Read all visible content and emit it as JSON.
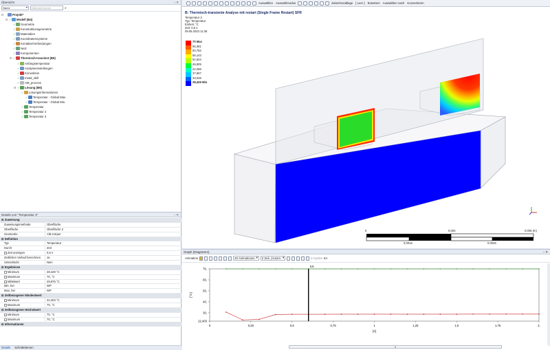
{
  "outline": {
    "title": "Übersicht",
    "filter_select": "Name",
    "filter_placeholder": "Übersicht durch",
    "tree": [
      {
        "label": "Projekt*",
        "bold": true,
        "indent": 0,
        "color": "#6b8fcf"
      },
      {
        "label": "Modell (B4)",
        "bold": true,
        "indent": 1,
        "color": "#5a9bd8"
      },
      {
        "label": "Geometrie",
        "bold": false,
        "indent": 2,
        "color": "#6ca86c"
      },
      {
        "label": "Konstruktionsgeometrie",
        "bold": false,
        "indent": 2,
        "color": "#c9a24a"
      },
      {
        "label": "Materialien",
        "bold": false,
        "indent": 2,
        "color": "#8aa6c9"
      },
      {
        "label": "Koordinatensysteme",
        "bold": false,
        "indent": 2,
        "color": "#7f9ab8"
      },
      {
        "label": "Kontakte/Verbindungen",
        "bold": false,
        "indent": 2,
        "color": "#c78a3a"
      },
      {
        "label": "Netz",
        "bold": false,
        "indent": 2,
        "color": "#66a37a"
      },
      {
        "label": "Komponenten",
        "bold": false,
        "indent": 2,
        "color": "#8c7fc0"
      },
      {
        "label": "Thermisch-transient (B5)",
        "bold": true,
        "indent": 2,
        "color": "#d04040"
      },
      {
        "label": "Anfangstemperatur",
        "bold": false,
        "indent": 3,
        "color": "#8fb35a"
      },
      {
        "label": "Analyseeinstellungen",
        "bold": false,
        "indent": 3,
        "color": "#6f95c7"
      },
      {
        "label": "Konvektion",
        "bold": false,
        "indent": 3,
        "color": "#d03c3c"
      },
      {
        "label": "metal_skill",
        "bold": false,
        "indent": 3,
        "color": "#7a9bc2"
      },
      {
        "label": "AM_process",
        "bold": false,
        "indent": 3,
        "color": "#b8b8b8"
      },
      {
        "label": "Lösung (B6)",
        "bold": true,
        "indent": 3,
        "color": "#5a9d5a"
      },
      {
        "label": "Lösungsinformationen",
        "bold": false,
        "indent": 4,
        "color": "#d0a040"
      },
      {
        "label": "Temperatur - Global Max.",
        "bold": false,
        "indent": 5,
        "color": "#4a7fc4"
      },
      {
        "label": "Temperatur - Global Min.",
        "bold": false,
        "indent": 5,
        "color": "#4a7fc4"
      },
      {
        "label": "Temperatur",
        "bold": false,
        "indent": 4,
        "color": "#5aa060"
      },
      {
        "label": "Temperatur 2",
        "bold": false,
        "indent": 4,
        "color": "#5aa060"
      },
      {
        "label": "Temperatur 3",
        "bold": false,
        "indent": 4,
        "color": "#5aa060"
      }
    ]
  },
  "details": {
    "title": "Details von \"Temperatur 3\"",
    "rows": [
      {
        "type": "sec",
        "k": "Zuweisung",
        "v": ""
      },
      {
        "type": "row",
        "k": "Zuweisungsmethode",
        "v": "Oberfläche"
      },
      {
        "type": "row",
        "k": "Oberfläche",
        "v": "Oberfläche 2"
      },
      {
        "type": "row",
        "k": "Geometrie",
        "v": "Alle Körper"
      },
      {
        "type": "sec",
        "k": "Definition",
        "v": ""
      },
      {
        "type": "row",
        "k": "Typ",
        "v": "Temperatur"
      },
      {
        "type": "row",
        "k": "Durch",
        "v": "Zeit"
      },
      {
        "type": "cb",
        "k": "Zeit anzeigen",
        "v": "0,6 s"
      },
      {
        "type": "row",
        "k": "Zeitlichen Verlauf berechnen",
        "v": "Ja"
      },
      {
        "type": "row",
        "k": "Unterdrückt",
        "v": "Nein"
      },
      {
        "type": "sec",
        "k": "Ergebnisse",
        "v": ""
      },
      {
        "type": "cb",
        "k": "Minimum",
        "v": "28,429 °C"
      },
      {
        "type": "cb",
        "k": "Maximum",
        "v": "70, °C"
      },
      {
        "type": "cb",
        "k": "Mittelwert",
        "v": "29,876 °C"
      },
      {
        "type": "row",
        "k": "Min. bei",
        "v": "WP"
      },
      {
        "type": "row",
        "k": "Max. bei",
        "v": "WP"
      },
      {
        "type": "sec",
        "k": "Zeitbezogener Mindestwert",
        "v": ""
      },
      {
        "type": "cb",
        "k": "Minimum",
        "v": "22,403 °C"
      },
      {
        "type": "cb",
        "k": "Maximum",
        "v": "70, °C"
      },
      {
        "type": "sec",
        "k": "Zeitbezogener Höchstwert",
        "v": ""
      },
      {
        "type": "cb",
        "k": "Minimum",
        "v": "70, °C"
      },
      {
        "type": "cb",
        "k": "Maximum",
        "v": "70, °C"
      },
      {
        "type": "sec",
        "k": "Informationen",
        "v": ""
      }
    ],
    "tabs": [
      "Details",
      "Schnittebenen"
    ]
  },
  "toolbar": {
    "auswaehlen": "Auswählen",
    "auswahlmodus": "Auswahlmodus",
    "zwischenablage": "Zwischenablage",
    "leer": "[ Leer ]",
    "erweitern": "Erweitern",
    "auswaehlen_nach": "Auswählen nach",
    "konvertieren": "Konvertieren"
  },
  "viewport": {
    "title": "B: Thermisch-transiente Analyse mit restart (Single Frame Restart) SFR",
    "info": [
      "Temperatur 3",
      "Typ: Temperatur",
      "Einheit: °C",
      "Zeit: 0,6 s",
      "09.05.2023 11:36"
    ],
    "legend": [
      {
        "label": "70 Max",
        "color": "#ff0000",
        "bold": true
      },
      {
        "label": "65,381",
        "color": "#ff5a00"
      },
      {
        "label": "60,762",
        "color": "#ffaa00"
      },
      {
        "label": "56,143",
        "color": "#ffff00"
      },
      {
        "label": "51,524",
        "color": "#b4ff00"
      },
      {
        "label": "46,905",
        "color": "#00ff3c"
      },
      {
        "label": "42,286",
        "color": "#00ffc8"
      },
      {
        "label": "37,667",
        "color": "#00c8ff"
      },
      {
        "label": "33,048",
        "color": "#0064ff"
      },
      {
        "label": "28,429 Min",
        "color": "#0000ff",
        "bold": true
      }
    ],
    "scale_top": [
      "0",
      "0,003",
      "0,006 (m)"
    ],
    "scale_bottom": [
      "0,0015",
      "0,0045"
    ]
  },
  "graph": {
    "title": "Graph (Diagramm)",
    "animation_label": "Animation",
    "frames": "20 Animationen",
    "duration": "2 Sek. (Autom.",
    "cycles": "3 Cycles",
    "sa": "SA",
    "cursor_label": "0,6",
    "unit_x": "[s]",
    "unit_y": "[°C]",
    "time_slot": "1"
  },
  "chart_data": {
    "type": "line",
    "xlim": [
      0,
      2
    ],
    "ylim": [
      22.403,
      70
    ],
    "x_ticks": [
      "0",
      "0,25",
      "0,5",
      "0,75",
      "1",
      "1,25",
      "1,5",
      "1,75",
      "2,"
    ],
    "y_ticks": [
      "70,",
      "60,",
      "50,",
      "40,",
      "30,",
      "22,403"
    ],
    "cursor_x": 0.6,
    "series": [
      {
        "color": "#2a9d2a",
        "x": [
          0.1,
          0.2,
          0.3,
          0.4,
          0.5,
          0.6,
          0.7,
          0.8,
          0.9,
          1.0,
          1.1,
          1.2,
          1.3,
          1.4,
          1.5,
          1.6,
          1.7,
          1.8,
          1.9,
          2.0
        ],
        "values": [
          70,
          70,
          70,
          70,
          70,
          70,
          70,
          70,
          70,
          70,
          70,
          70,
          70,
          70,
          70,
          70,
          70,
          70,
          70,
          70
        ]
      },
      {
        "color": "#c42020",
        "x": [
          0.1,
          0.2,
          0.3,
          0.4,
          0.5,
          0.6,
          0.7,
          0.8,
          0.9,
          1.0,
          1.1,
          1.2,
          1.3,
          1.4,
          1.5,
          1.6,
          1.7,
          1.8,
          1.9,
          2.0
        ],
        "values": [
          30.6,
          23.5,
          24.0,
          28.4,
          28.6,
          28.6,
          28.6,
          28.7,
          28.7,
          28.7,
          28.7,
          28.7,
          28.7,
          28.7,
          28.7,
          28.8,
          28.8,
          28.8,
          28.8,
          28.8
        ]
      }
    ]
  }
}
